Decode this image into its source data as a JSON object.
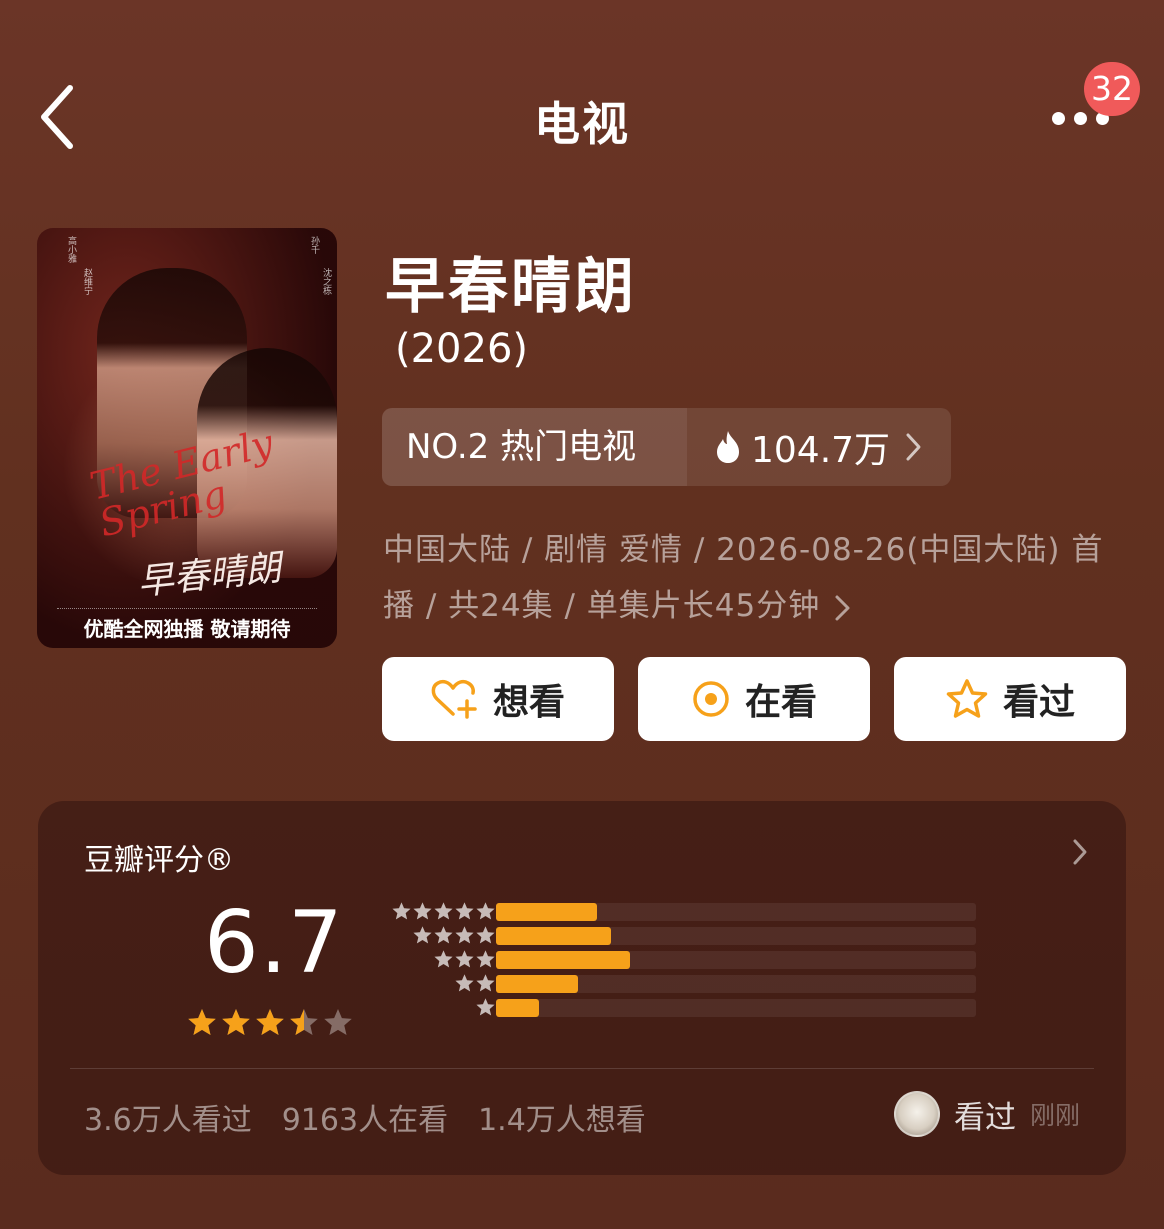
{
  "header": {
    "title": "电视",
    "notification_count": "32"
  },
  "poster": {
    "english_title": "The Early Spring",
    "chinese_title": "早春晴朗",
    "tagline": "优酷全网独播 敬请期待",
    "cast_right": "孙千",
    "cast_right_2": "沈之栋",
    "cast_left": "高小雅",
    "director_left": "赵维宁"
  },
  "show": {
    "title": "早春晴朗",
    "year": "(2026)",
    "rank_text": "NO.2 热门电视",
    "heat": "104.7万",
    "meta_line1": "中国大陆 / 剧情 爱情 / 2026-08-26(中国大陆) 首",
    "meta_line2": "播 / 共24集 / 单集片长45分钟"
  },
  "actions": [
    {
      "label": "想看",
      "icon": "heart-plus-icon"
    },
    {
      "label": "在看",
      "icon": "target-circle-icon"
    },
    {
      "label": "看过",
      "icon": "star-outline-icon"
    }
  ],
  "rating": {
    "label": "豆瓣评分®",
    "score": "6.7",
    "stars": 3.5,
    "distribution": [
      {
        "stars": 5,
        "fraction": 0.21
      },
      {
        "stars": 4,
        "fraction": 0.24
      },
      {
        "stars": 3,
        "fraction": 0.28
      },
      {
        "stars": 2,
        "fraction": 0.17
      },
      {
        "stars": 1,
        "fraction": 0.09
      }
    ],
    "stats": [
      "3.6万人看过",
      "9163人在看",
      "1.4万人想看"
    ],
    "user_status": "看过",
    "user_time": "刚刚"
  },
  "colors": {
    "accent_orange": "#f6a11a",
    "badge_red": "#f05a5a",
    "background": "#61301f"
  }
}
